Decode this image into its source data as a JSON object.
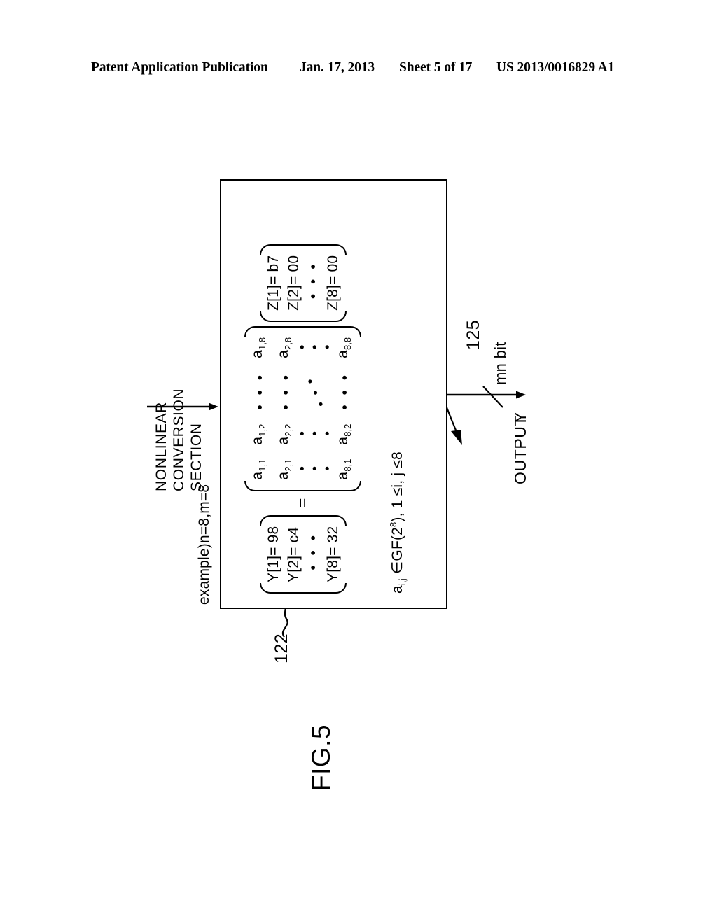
{
  "header": {
    "publication": "Patent Application Publication",
    "date": "Jan. 17, 2013",
    "sheet": "Sheet 5 of 17",
    "patent_number": "US 2013/0016829 A1"
  },
  "figure": {
    "label": "FIG.5",
    "nonlinear_section_label_lines": [
      "NONLINEAR",
      "CONVERSION",
      "SECTION"
    ],
    "nonlinear_section_label": "NONLINEAR CONVERSION SECTION",
    "example_note": "example)n=8,m=8",
    "reference_box": "122",
    "reference_matrix": "125",
    "equation": {
      "equals_sign": "=",
      "y_vector": {
        "name": "Y",
        "cells": [
          "Y[1]= 98",
          "Y[2]= c4",
          "Y[8]= 32"
        ],
        "ellipsis": "• • •"
      },
      "matrix": {
        "name": "A",
        "rows": [
          [
            "a",
            "1,1",
            "a",
            "1,2",
            "• • •",
            "a",
            "1,8"
          ],
          [
            "a",
            "2,1",
            "a",
            "2,2",
            "• • •",
            "a",
            "2,8"
          ],
          [
            "a",
            "8,1",
            "a",
            "8,2",
            "• • •",
            "a",
            "8,8"
          ]
        ],
        "cells": {
          "r1c1_base": "a",
          "r1c1_sub": "1,1",
          "r1c2_base": "a",
          "r1c2_sub": "1,2",
          "r1c4_base": "a",
          "r1c4_sub": "1,8",
          "r2c1_base": "a",
          "r2c1_sub": "2,1",
          "r2c2_base": "a",
          "r2c2_sub": "2,2",
          "r2c4_base": "a",
          "r2c4_sub": "2,8",
          "r4c1_base": "a",
          "r4c1_sub": "8,1",
          "r4c2_base": "a",
          "r4c2_sub": "8,2",
          "r4c4_base": "a",
          "r4c4_sub": "8,8"
        },
        "hdots": "• • •",
        "vdots": "• • •",
        "ddots": "• • •"
      },
      "z_vector": {
        "name": "Z",
        "cells": [
          "Z[1]= b7",
          "Z[2]= 00",
          "Z[8]= 00"
        ],
        "ellipsis": "• • •"
      }
    },
    "gf_note": {
      "prefix": "a",
      "subscript": "i,j",
      "membership": " ∈GF(2",
      "exponent": "8",
      "suffix": "), 1 ≤i, j ≤8"
    },
    "output": {
      "label": "OUTPUT",
      "signal": "Y",
      "bit_width": "mn bit"
    }
  },
  "colors": {
    "ink": "#000000",
    "page": "#ffffff"
  }
}
